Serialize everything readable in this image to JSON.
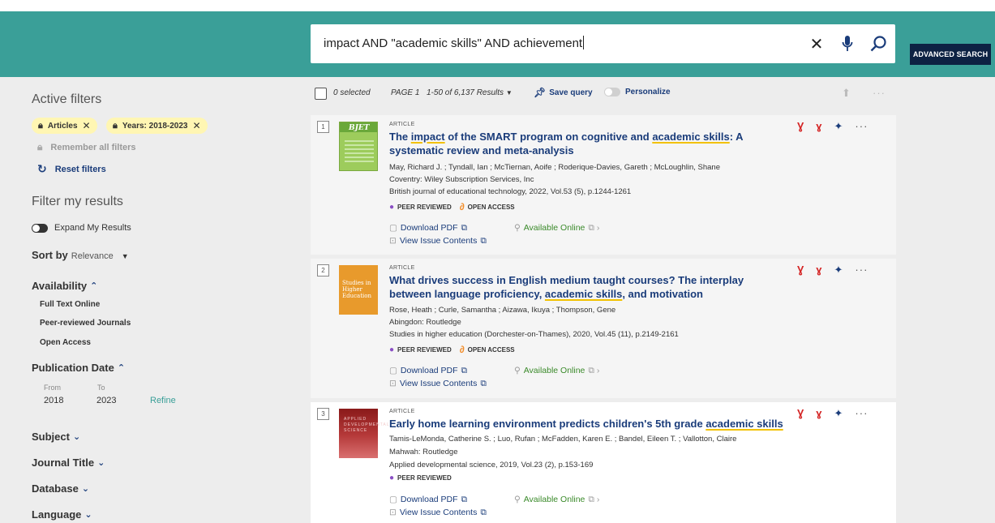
{
  "search": {
    "query": "impact AND \"academic skills\" AND achievement",
    "clear_icon": "close-icon",
    "voice_icon": "microphone-icon",
    "search_icon": "search-icon",
    "advanced_label": "ADVANCED SEARCH"
  },
  "sidebar": {
    "active_filters_title": "Active filters",
    "chips": [
      {
        "label": "Articles",
        "icon": "lock-icon"
      },
      {
        "label": "Years: 2018-2023",
        "icon": "lock-icon"
      }
    ],
    "remember_label": "Remember all filters",
    "reset_label": "Reset filters",
    "filter_title": "Filter my results",
    "expand_label": "Expand My Results",
    "sort_label": "Sort by",
    "sort_value": "Relevance",
    "availability_title": "Availability",
    "availability_items": [
      "Full Text Online",
      "Peer-reviewed Journals",
      "Open Access"
    ],
    "pubdate_title": "Publication Date",
    "from_label": "From",
    "to_label": "To",
    "from_value": "2018",
    "to_value": "2023",
    "refine_label": "Refine",
    "sections": [
      "Subject",
      "Journal Title",
      "Database",
      "Language"
    ]
  },
  "results_bar": {
    "selected": "0 selected",
    "page": "PAGE 1",
    "range": "1-50 of 6,137 Results",
    "save_query": "Save query",
    "personalize": "Personalize"
  },
  "results": [
    {
      "num": "1",
      "type": "ARTICLE",
      "title_parts": [
        "The ",
        "impact",
        " of the SMART program on cognitive and ",
        "academic skills",
        ": A systematic review and meta-analysis"
      ],
      "authors": "May, Richard J. ; Tyndall, Ian ; McTiernan, Aoife ; Roderique-Davies, Gareth ; McLoughlin, Shane",
      "publisher": "Coventry: Wiley Subscription Services, Inc",
      "source": "British journal of educational technology, 2022, Vol.53 (5), p.1244-1261",
      "peer": "PEER REVIEWED",
      "oa": "OPEN ACCESS",
      "download": "Download PDF",
      "available": "Available Online",
      "issue": "View Issue Contents",
      "thumb_text": "BJET"
    },
    {
      "num": "2",
      "type": "ARTICLE",
      "title_parts": [
        "What drives success in English medium taught courses? The interplay between language proficiency, ",
        "academic skills",
        ", and motivation"
      ],
      "authors": "Rose, Heath ; Curle, Samantha ; Aizawa, Ikuya ; Thompson, Gene",
      "publisher": "Abingdon: Routledge",
      "source": "Studies in higher education (Dorchester-on-Thames), 2020, Vol.45 (11), p.2149-2161",
      "peer": "PEER REVIEWED",
      "oa": "OPEN ACCESS",
      "download": "Download PDF",
      "available": "Available Online",
      "issue": "View Issue Contents",
      "thumb_text": "Studies in Higher Education"
    },
    {
      "num": "3",
      "type": "ARTICLE",
      "title_parts": [
        "Early home learning environment predicts children's 5th grade ",
        "academic skills"
      ],
      "authors": "Tamis-LeMonda, Catherine S. ; Luo, Rufan ; McFadden, Karen E. ; Bandel, Eileen T. ; Vallotton, Claire",
      "publisher": "Mahwah: Routledge",
      "source": "Applied developmental science, 2019, Vol.23 (2), p.153-169",
      "peer": "PEER REVIEWED",
      "download": "Download PDF",
      "available": "Available Online",
      "issue": "View Issue Contents",
      "thumb_text": "APPLIED DEVELOPMENTAL SCIENCE"
    }
  ],
  "colors": {
    "header": "#3a9f98",
    "advanced_button": "#0d2243",
    "title_link": "#1a3c7a",
    "highlight": "#f2c100",
    "chip": "#fff6b3",
    "cite_icon": "#d42323",
    "available": "#3a8a2a"
  }
}
